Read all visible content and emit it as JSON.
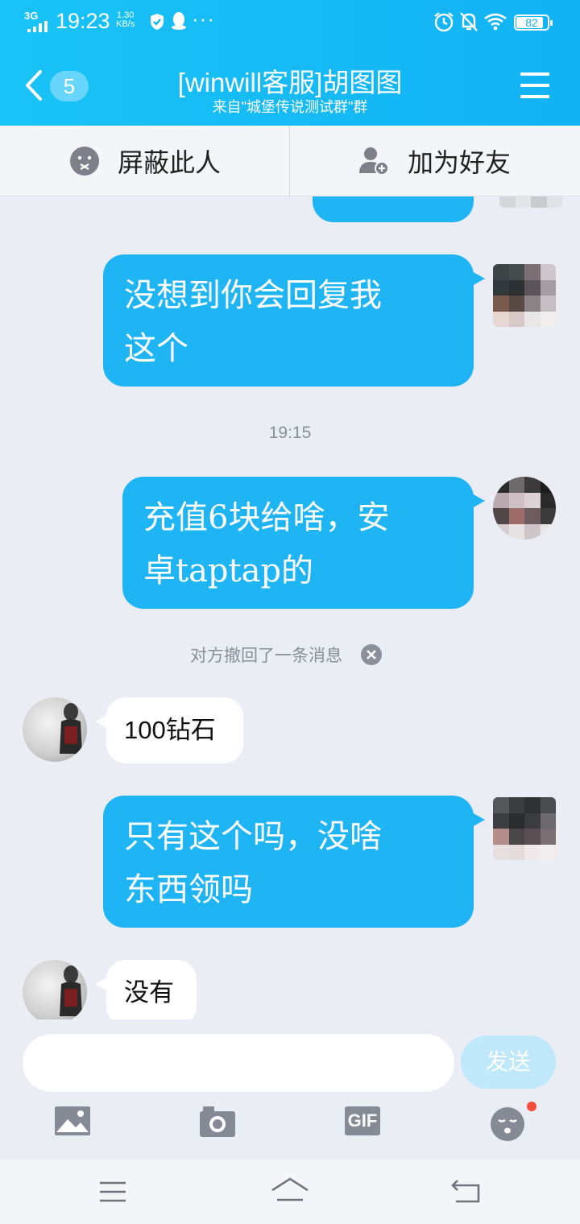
{
  "status_bar": {
    "network": "3G",
    "time": "19:23",
    "speed_value": "1.30",
    "speed_unit": "KB/s",
    "battery": "82"
  },
  "header": {
    "unread_count": "5",
    "title": "[winwill客服]胡图图",
    "subtitle": "来自\"城堡传说测试群\"群"
  },
  "actions": {
    "block_label": "屏蔽此人",
    "add_friend_label": "加为好友"
  },
  "messages": {
    "msg1_line1": "没想到你会回复我",
    "msg1_line2": "这个",
    "timestamp": "19:15",
    "msg2_line1": "充值6块给啥，安",
    "msg2_line2": "卓taptap的",
    "recall_notice": "对方撤回了一条消息",
    "msg3": "100钻石",
    "msg4_line1": "只有这个吗，没啥",
    "msg4_line2": "东西领吗",
    "msg5": "没有"
  },
  "input": {
    "send_label": "发送",
    "gif_label": "GIF"
  },
  "colors": {
    "header": "#15b8f6",
    "outgoing_bubble": "#1fb5f5",
    "incoming_bubble": "#ffffff",
    "send_button": "#bfe8fb"
  }
}
